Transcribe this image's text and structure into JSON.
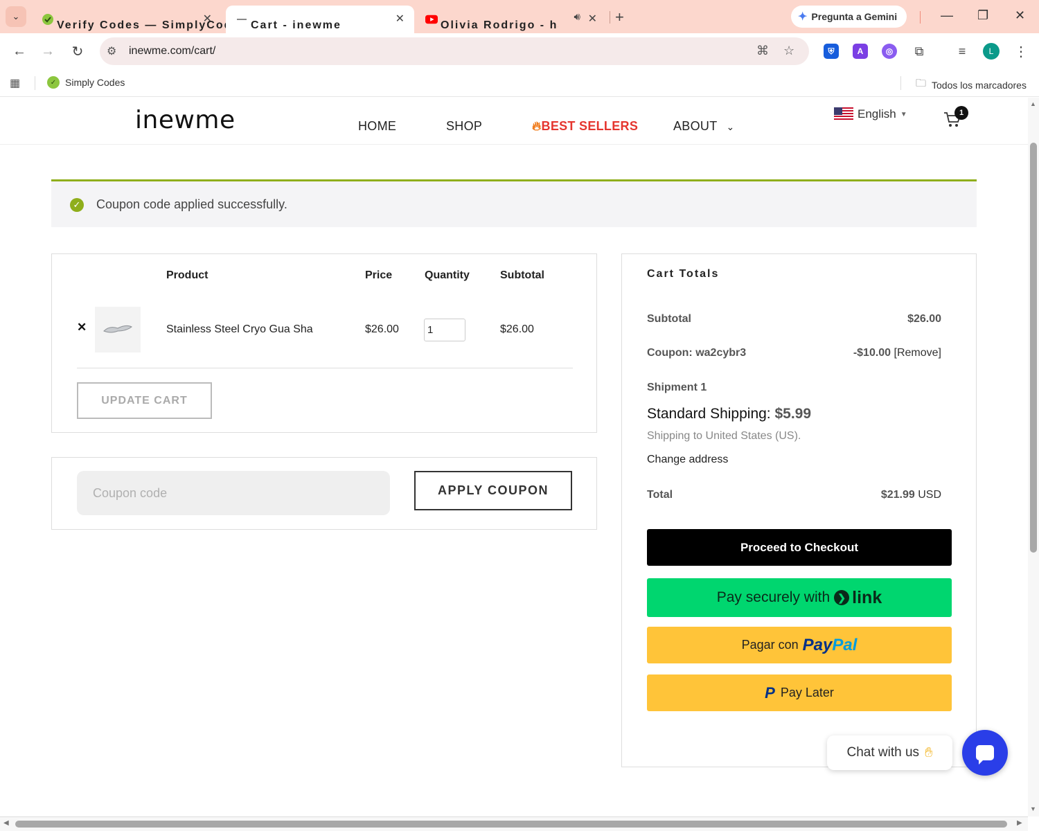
{
  "browser": {
    "tabs": [
      {
        "title": "Verify Codes — SimplyCodes",
        "active": false
      },
      {
        "title": "Cart - inewme",
        "active": true
      },
      {
        "title": "Olivia Rodrigo - happier (Ly",
        "active": false
      }
    ],
    "gemini_label": "Pregunta a Gemini",
    "url": "inewme.com/cart/",
    "bookmarks": {
      "simply_codes": "Simply Codes",
      "all_bookmarks": "Todos los marcadores"
    },
    "extensions": [
      {
        "icon": "bitwarden-shield-icon",
        "color": "#175ddc",
        "glyph": "⛨"
      },
      {
        "icon": "a-extension-icon",
        "color": "#7b3fe4",
        "glyph": "A"
      },
      {
        "icon": "purple-extension-icon",
        "color": "#8a5cf0",
        "glyph": "◎"
      }
    ],
    "avatar_letter": "L"
  },
  "site": {
    "logo": "inewme",
    "nav": {
      "home": "HOME",
      "shop": "SHOP",
      "best_sellers": "BEST SELLERS",
      "about": "ABOUT"
    },
    "language": "English",
    "cart_count": "1"
  },
  "notice": {
    "message": "Coupon code applied successfully."
  },
  "cart": {
    "headers": {
      "product": "Product",
      "price": "Price",
      "quantity": "Quantity",
      "subtotal": "Subtotal"
    },
    "items": [
      {
        "product": "Stainless Steel Cryo Gua Sha",
        "price": "$26.00",
        "quantity": "1",
        "subtotal": "$26.00"
      }
    ],
    "update_label": "UPDATE CART"
  },
  "coupon": {
    "placeholder": "Coupon code",
    "apply_label": "APPLY COUPON"
  },
  "totals": {
    "title": "Cart Totals",
    "subtotal_label": "Subtotal",
    "subtotal_value": "$26.00",
    "coupon_label": "Coupon: wa2cybr3",
    "coupon_value": "-$10.00",
    "coupon_remove": "[Remove]",
    "shipment_label": "Shipment 1",
    "shipping_method": "Standard Shipping:",
    "shipping_price": "$5.99",
    "shipping_to": "Shipping to United States (US).",
    "change_address": "Change address",
    "total_label": "Total",
    "total_value": "$21.99",
    "total_currency": "USD",
    "checkout_label": "Proceed to Checkout",
    "link_pay_label": "Pay securely with",
    "link_brand": "link",
    "paypal_label": "Pagar con",
    "paypal_brand_a": "Pay",
    "paypal_brand_b": "Pal",
    "pay_later_label": "Pay Later"
  },
  "chat": {
    "label": "Chat with us"
  },
  "colors": {
    "accent_green": "#8fae1b",
    "best_sellers_red": "#e5362f",
    "link_green": "#00d66f",
    "paypal_yellow": "#ffc439",
    "chat_blue": "#2a3ee8",
    "tabbar": "#fcd7cd"
  }
}
